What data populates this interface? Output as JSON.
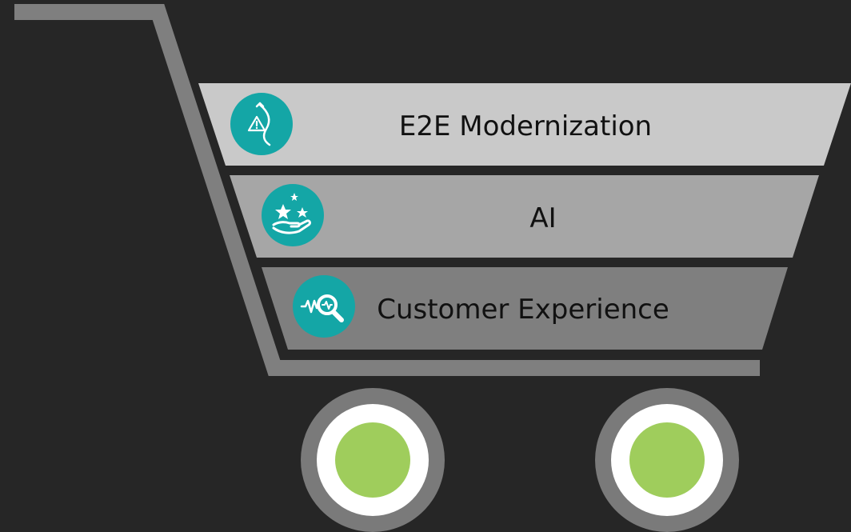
{
  "diagram": {
    "tiers": [
      {
        "label": "E2E Modernization",
        "icon": "path-warning-icon",
        "fill": "#c9c9c9"
      },
      {
        "label": "AI",
        "icon": "hand-stars-icon",
        "fill": "#a6a6a6"
      },
      {
        "label": "Customer Experience",
        "icon": "waveform-search-icon",
        "fill": "#7f7f7f"
      }
    ],
    "colors": {
      "background": "#262626",
      "cart_frame": "#7f7f7f",
      "icon_teal": "#14a6a6",
      "wheel_ring": "#7a7a7a",
      "wheel_inner_ring": "#ffffff",
      "wheel_hub": "#9fcd5c"
    }
  }
}
